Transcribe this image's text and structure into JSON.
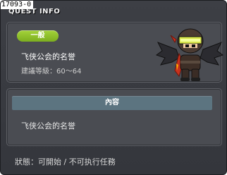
{
  "window": {
    "quest_id": "17093-0",
    "title": "QUEST INFO"
  },
  "summary": {
    "category_badge": "一般",
    "quest_name": "飞侠公会的名誉",
    "level_label": "建議等級",
    "level_separator": "：",
    "level_range": "60～64",
    "character_icon": "ninja-npc-icon"
  },
  "content": {
    "header": "內容",
    "text": "飞侠公会的名誉"
  },
  "status": {
    "label": "狀態",
    "separator": "：",
    "value": "可開始 / 不可执行任務"
  },
  "colors": {
    "badge_green": "#8fc22a",
    "header_bar": "#5c7480",
    "window_bg": "#3a3c42"
  }
}
